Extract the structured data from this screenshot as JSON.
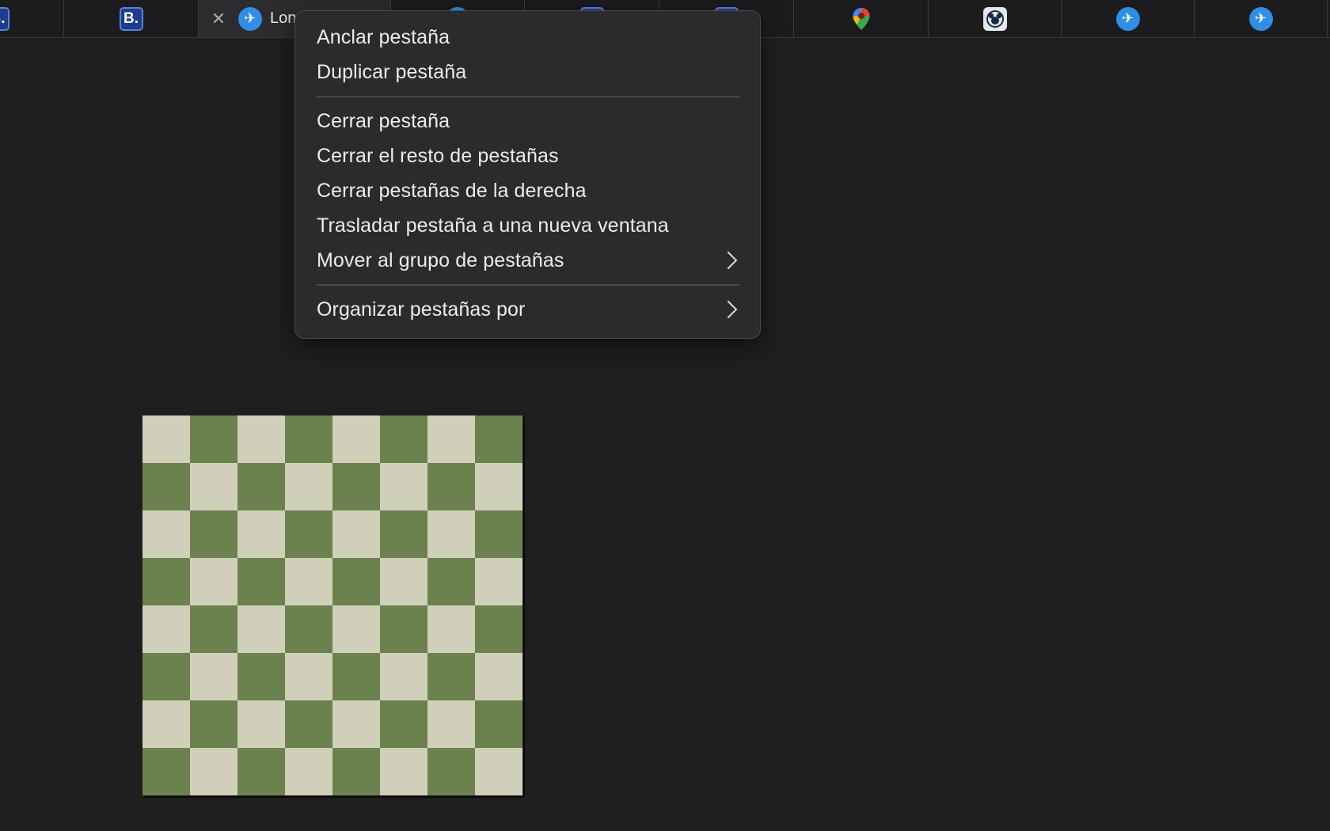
{
  "tabbar": {
    "tabs": [
      {
        "favicon": "booking-icon",
        "badge": "B."
      },
      {
        "favicon": "booking-icon",
        "badge": "B."
      },
      {
        "favicon": "plane-icon",
        "title": "Lon",
        "active": true
      },
      {
        "favicon": "plane-icon"
      },
      {
        "favicon": "booking-icon"
      },
      {
        "favicon": "booking-icon"
      },
      {
        "favicon": "google-maps-icon"
      },
      {
        "favicon": "disney-icon"
      },
      {
        "favicon": "plane-icon"
      },
      {
        "favicon": "plane-icon"
      }
    ]
  },
  "context_menu": {
    "items": [
      {
        "label": "Anclar pestaña"
      },
      {
        "label": "Duplicar pestaña"
      },
      {
        "label": "Cerrar pestaña"
      },
      {
        "label": "Cerrar el resto de pestañas"
      },
      {
        "label": "Cerrar pestañas de la derecha"
      },
      {
        "label": "Trasladar pestaña a una nueva ventana"
      },
      {
        "label": "Mover al grupo de pestañas",
        "submenu": true
      },
      {
        "label": "Organizar pestañas por",
        "submenu": true
      }
    ]
  },
  "chessboard": {
    "light_color": "#d0d0ba",
    "dark_color": "#6b814e"
  },
  "colors": {
    "background": "#1f1f1f",
    "menu_bg": "#2b2b2d",
    "accent_blue": "#2f8ee5",
    "booking_blue": "#1d3b8f"
  }
}
